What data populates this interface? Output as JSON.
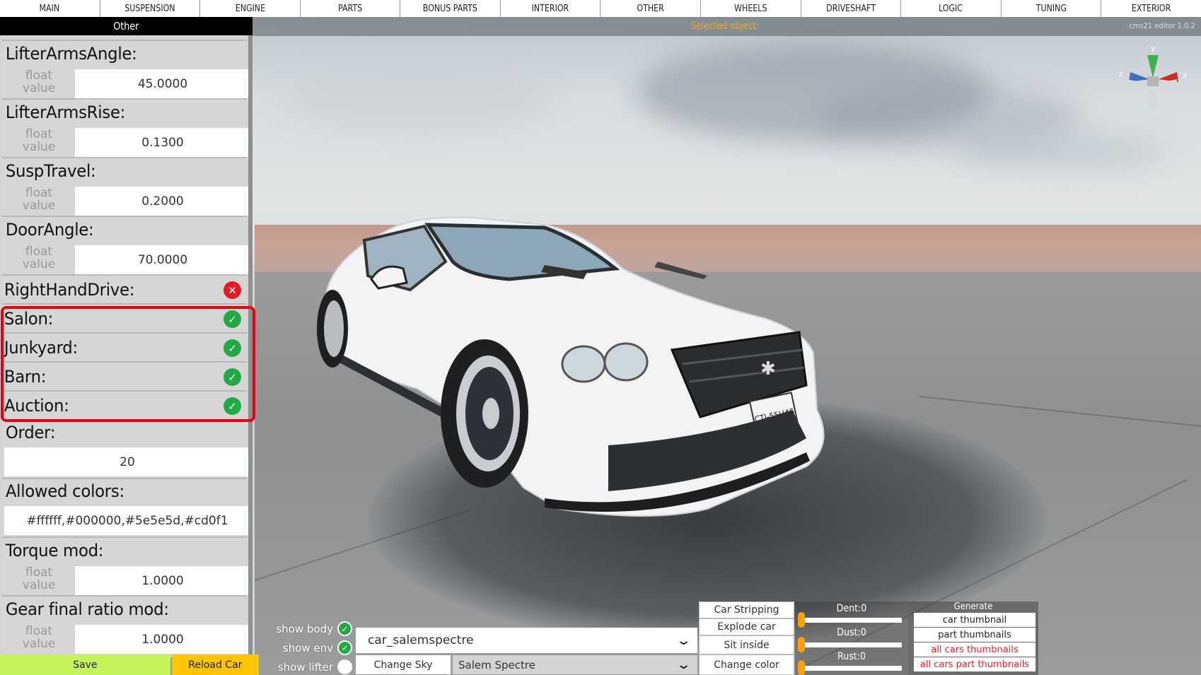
{
  "tabs": [
    {
      "label": "MAIN"
    },
    {
      "label": "SUSPENSION"
    },
    {
      "label": "ENGINE"
    },
    {
      "label": "PARTS"
    },
    {
      "label": "BONUS PARTS"
    },
    {
      "label": "INTERIOR"
    },
    {
      "label": "OTHER"
    },
    {
      "label": "WHEELS"
    },
    {
      "label": "DRIVESHAFT"
    },
    {
      "label": "LOGIC"
    },
    {
      "label": "TUNING"
    },
    {
      "label": "EXTERIOR"
    }
  ],
  "status": {
    "selected_object_label": "Selected object:",
    "version": "cms21 editor 1.0.2"
  },
  "gizmo": {
    "x_label": "x",
    "y_label": "y",
    "z_label": "z"
  },
  "sidebar": {
    "title": "Other",
    "float_hint": "float value",
    "float_arrows": "⟷",
    "fields": {
      "lifter_arms_angle": {
        "label": "LifterArmsAngle:",
        "value": "45.0000"
      },
      "lifter_arms_rise": {
        "label": "LifterArmsRise:",
        "value": "0.1300"
      },
      "susp_travel": {
        "label": "SuspTravel:",
        "value": "0.2000"
      },
      "door_angle": {
        "label": "DoorAngle:",
        "value": "70.0000"
      },
      "right_hand_drive": {
        "label": "RightHandDrive:",
        "checked": false
      },
      "salon": {
        "label": "Salon:",
        "checked": true
      },
      "junkyard": {
        "label": "Junkyard:",
        "checked": true
      },
      "barn": {
        "label": "Barn:",
        "checked": true
      },
      "auction": {
        "label": "Auction:",
        "checked": true
      },
      "order": {
        "label": "Order:",
        "value": "20"
      },
      "allowed_colors": {
        "label": "Allowed colors:",
        "value": "#ffffff,#000000,#5e5e5d,#cd0f1"
      },
      "torque_mod": {
        "label": "Torque mod:",
        "value": "1.0000"
      },
      "gear_final_ratio_mod": {
        "label": "Gear final ratio mod:",
        "value": "1.0000"
      }
    },
    "save_label": "Save",
    "reload_label": "Reload Car"
  },
  "bottom": {
    "toggles": [
      {
        "label": "show body",
        "on": true
      },
      {
        "label": "show env",
        "on": true
      },
      {
        "label": "show lifter",
        "on": false
      }
    ],
    "car_select_value": "car_salemspectre",
    "change_sky_label": "Change Sky",
    "brand_select_value": "Salem Spectre",
    "actions": [
      "Car Stripping",
      "Explode car",
      "Sit inside",
      "Change color"
    ],
    "sliders": [
      {
        "label": "Dent:0",
        "value": 0
      },
      {
        "label": "Dust:0",
        "value": 0
      },
      {
        "label": "Rust:0",
        "value": 0
      }
    ],
    "generate": {
      "title": "Generate",
      "buttons": [
        "car thumbnail",
        "part thumbnails",
        "all cars thumbnails",
        "all cars part thumbnails"
      ]
    }
  },
  "scene": {
    "license_plate": "CTJ-55U46"
  },
  "colors": {
    "accent_orange": "#f5a623",
    "check_green": "#22a845",
    "cross_red": "#e21b23",
    "highlight_red": "#e8000a",
    "save_green": "#c6f25b",
    "reload_yellow": "#ffc400",
    "slider_orange": "#ff9f00"
  }
}
